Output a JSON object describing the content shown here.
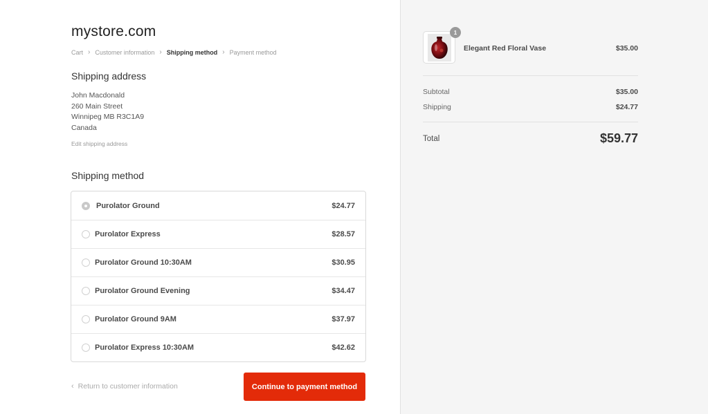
{
  "store": {
    "name": "mystore.com"
  },
  "breadcrumb": {
    "items": [
      {
        "label": "Cart",
        "current": false
      },
      {
        "label": "Customer information",
        "current": false
      },
      {
        "label": "Shipping method",
        "current": true
      },
      {
        "label": "Payment method",
        "current": false
      }
    ]
  },
  "shipping_address": {
    "title": "Shipping address",
    "lines": [
      "John Macdonald",
      "260 Main Street",
      "Winnipeg MB R3C1A9",
      "Canada"
    ],
    "edit_label": "Edit shipping address"
  },
  "shipping_method": {
    "title": "Shipping method",
    "selected_index": 0,
    "options": [
      {
        "name": "Purolator Ground",
        "price": "$24.77"
      },
      {
        "name": "Purolator Express",
        "price": "$28.57"
      },
      {
        "name": "Purolator Ground 10:30AM",
        "price": "$30.95"
      },
      {
        "name": "Purolator Ground Evening",
        "price": "$34.47"
      },
      {
        "name": "Purolator Ground 9AM",
        "price": "$37.97"
      },
      {
        "name": "Purolator Express 10:30AM",
        "price": "$42.62"
      }
    ]
  },
  "footer": {
    "return_label": "Return to customer information",
    "continue_label": "Continue to payment method"
  },
  "order_summary": {
    "product": {
      "name": "Elegant Red Floral Vase",
      "price": "$35.00",
      "quantity": "1"
    },
    "subtotal_label": "Subtotal",
    "subtotal_value": "$35.00",
    "shipping_label": "Shipping",
    "shipping_value": "$24.77",
    "total_label": "Total",
    "total_value": "$59.77"
  },
  "colors": {
    "accent": "#e32b09",
    "sidebar_bg": "#f5f5f5"
  }
}
